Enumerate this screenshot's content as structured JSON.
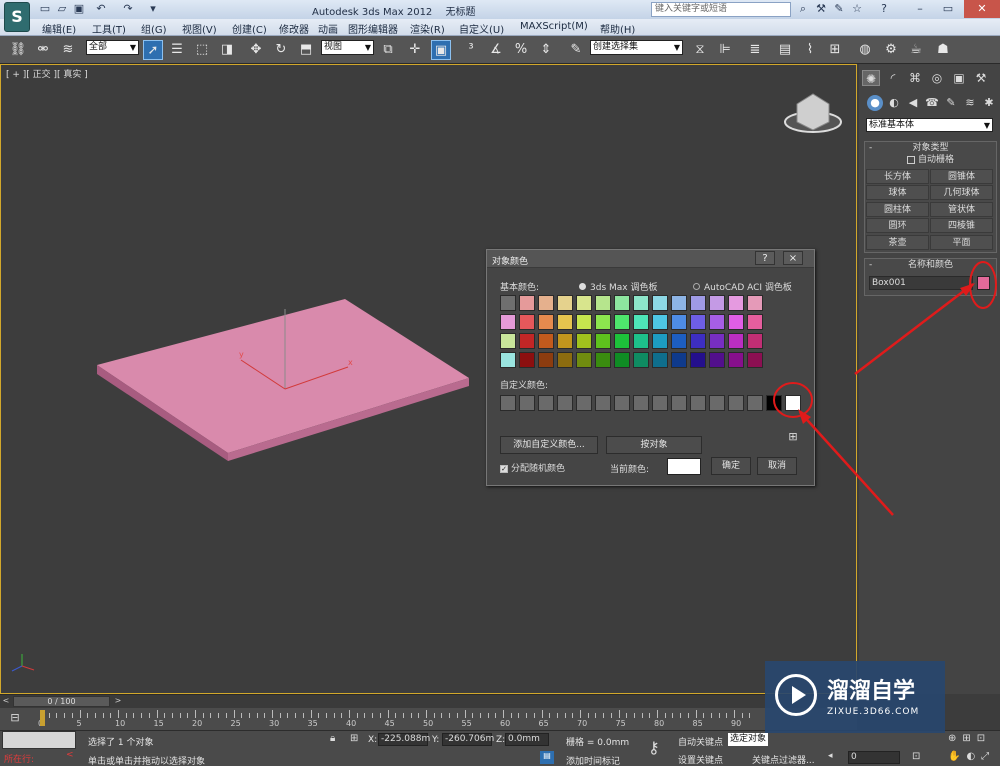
{
  "titlebar": {
    "app_title": "Autodesk 3ds Max  2012",
    "doc_title": "无标题",
    "search_placeholder": "键入关键字或短语",
    "logo_letter": "S"
  },
  "menu": [
    "编辑(E)",
    "工具(T)",
    "组(G)",
    "视图(V)",
    "创建(C)",
    "修改器",
    "动画",
    "图形编辑器",
    "渲染(R)",
    "自定义(U)",
    "MAXScript(M)",
    "帮助(H)"
  ],
  "toolbar": {
    "selection_filter": "全部",
    "ref_coord": "视图",
    "named_selection": "创建选择集"
  },
  "viewport": {
    "label": "[ + ][ 正交 ][ 真实 ]"
  },
  "command_panel": {
    "primitive_type": "标准基本体",
    "object_type_header": "对象类型",
    "autogrid_label": "自动栅格",
    "object_buttons": [
      "长方体",
      "圆锥体",
      "球体",
      "几何球体",
      "圆柱体",
      "管状体",
      "圆环",
      "四棱锥",
      "茶壶",
      "平面"
    ],
    "name_color_header": "名称和颜色",
    "object_name": "Box001",
    "object_color": "#e36a9a"
  },
  "dialog": {
    "title": "对象颜色",
    "help_label": "?",
    "close_label": "×",
    "basic_colors_label": "基本颜色:",
    "palette_max": "3ds Max 调色板",
    "palette_aci": "AutoCAD ACI 调色板",
    "custom_colors_label": "自定义颜色:",
    "add_custom_button": "添加自定义颜色...",
    "by_object_button": "按对象",
    "assign_random_label": "分配随机颜色",
    "current_color_label": "当前颜色:",
    "current_color": "#ffffff",
    "ok_button": "确定",
    "cancel_button": "取消",
    "basic_colors": [
      [
        "#6f6f6f",
        "#e59a9a",
        "#e5b08d",
        "#e5d28d",
        "#d8e58d",
        "#b6e58d",
        "#8de59f",
        "#8de5c9",
        "#8dd8e5",
        "#8db4e5",
        "#9f9ae5",
        "#c49ae5",
        "#e59ae0",
        "#e59ab8"
      ],
      [
        "#e59ad7",
        "#e5585b",
        "#e58a4e",
        "#e5c44e",
        "#c6e54e",
        "#8ce54e",
        "#4ee56c",
        "#4ee5b8",
        "#4ec7e5",
        "#4e8ce5",
        "#6e5ee5",
        "#a65ee5",
        "#e05ee5",
        "#e55e9e"
      ],
      [
        "#c8e59a",
        "#c12626",
        "#c15a1d",
        "#c1951d",
        "#a0c11d",
        "#5ec11d",
        "#1dc13a",
        "#1dc18a",
        "#1d9cc1",
        "#1d5ec1",
        "#3d2ec1",
        "#772ec1",
        "#bb2ec1",
        "#c12e74"
      ],
      [
        "#9ae5e0",
        "#8c0f0f",
        "#8c3c0f",
        "#8c6c0f",
        "#708c0f",
        "#3a8c0f",
        "#0f8c24",
        "#0f8c62",
        "#0f6e8c",
        "#0f3a8c",
        "#240f8c",
        "#520f8c",
        "#870f8c",
        "#8c0f52"
      ]
    ],
    "custom_colors": [
      "#6a6a6a",
      "#6a6a6a",
      "#6a6a6a",
      "#6a6a6a",
      "#6a6a6a",
      "#6a6a6a",
      "#6a6a6a",
      "#6a6a6a",
      "#6a6a6a",
      "#6a6a6a",
      "#6a6a6a",
      "#6a6a6a",
      "#6a6a6a",
      "#6a6a6a",
      "#000000",
      "#ffffff"
    ]
  },
  "timeline": {
    "frame_counter": "0 / 100",
    "ticks": [
      "0",
      "5",
      "10",
      "15",
      "20",
      "25",
      "30",
      "35",
      "40",
      "45",
      "50",
      "55",
      "60",
      "65",
      "70",
      "75",
      "80",
      "85",
      "90"
    ]
  },
  "status": {
    "selection_status": "选择了 1 个对象",
    "prompt": "单击或单击并拖动以选择对象",
    "running_label": "所在行:",
    "x_label": "X:",
    "x_value": "-225.088m",
    "y_label": "Y:",
    "y_value": "-260.706m",
    "z_label": "Z:",
    "z_value": "0.0mm",
    "grid": "栅格 = 0.0mm",
    "add_time_tag": "添加时间标记",
    "autokey": "自动关键点",
    "selected": "选定对象",
    "set_key": "设置关键点",
    "key_filters": "关键点过滤器...",
    "frame_value": "0"
  },
  "watermark": {
    "brand": "溜溜自学",
    "url": "ZIXUE.3D66.COM"
  },
  "colors": {
    "box_color": "#d98aac",
    "annotation_red": "#e01b1b",
    "selection_blue": "#2e6fb0"
  }
}
